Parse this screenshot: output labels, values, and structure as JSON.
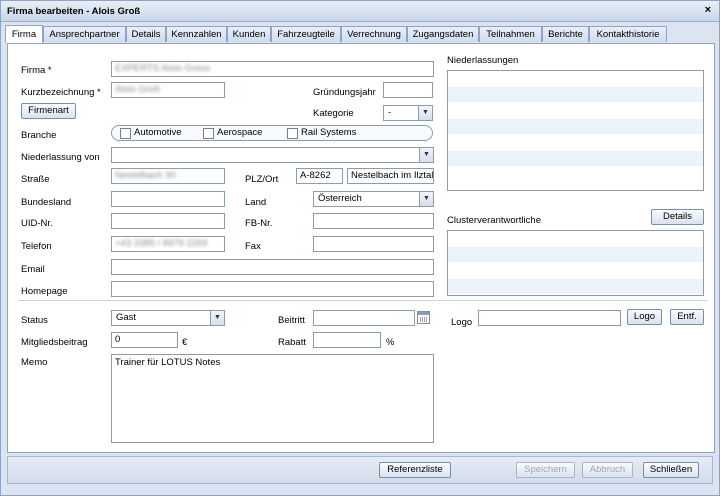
{
  "window": {
    "title": "Firma bearbeiten - Alois Groß",
    "close_glyph": "×"
  },
  "tabs": [
    "Firma",
    "Ansprechpartner",
    "Details",
    "Kennzahlen",
    "Kunden",
    "Fahrzeugteile",
    "Verrechnung",
    "Zugangsdaten",
    "Teilnahmen",
    "Berichte",
    "Kontakthistorie"
  ],
  "form": {
    "firma_label": "Firma *",
    "firma_value": "EXPERTS Alois Gross",
    "kurz_label": "Kurzbezeichnung *",
    "kurz_value": "Alois Groß",
    "firmenart_button": "Firmenart",
    "gruendung_label": "Gründungsjahr",
    "gruendung_value": "",
    "kategorie_label": "Kategorie",
    "kategorie_value": "-",
    "branche_label": "Branche",
    "branche_options": [
      "Automotive",
      "Aerospace",
      "Rail Systems"
    ],
    "nieder_von_label": "Niederlassung von",
    "nieder_von_value": "",
    "strasse_label": "Straße",
    "strasse_value": "Nestelbach 30",
    "plzort_label": "PLZ/Ort",
    "plz_value": "A-8262",
    "ort_value": "Nestelbach im Ilztal",
    "bundesland_label": "Bundesland",
    "bundesland_value": "",
    "land_label": "Land",
    "land_value": "Österreich",
    "uid_label": "UID-Nr.",
    "uid_value": "",
    "fb_label": "FB-Nr.",
    "fb_value": "",
    "telefon_label": "Telefon",
    "telefon_value": "+43 3385 / 8979 2269",
    "fax_label": "Fax",
    "fax_value": "",
    "email_label": "Email",
    "email_value": "",
    "homepage_label": "Homepage",
    "homepage_value": "",
    "status_label": "Status",
    "status_value": "Gast",
    "beitritt_label": "Beitritt",
    "beitritt_value": "",
    "logo_label": "Logo",
    "logo_value": "",
    "logo_button": "Logo",
    "entf_button": "Entf.",
    "mitglied_label": "Mitgliedsbeitrag",
    "mitglied_value": "0",
    "euro": "€",
    "rabatt_label": "Rabatt",
    "rabatt_value": "",
    "percent": "%",
    "memo_label": "Memo",
    "memo_value": "Trainer für LOTUS Notes"
  },
  "right": {
    "niederlassungen_label": "Niederlassungen",
    "cluster_label": "Clusterverantwortliche",
    "details_button": "Details"
  },
  "footer": {
    "referenzliste": "Referenzliste",
    "speichern": "Speichern",
    "abbruch": "Abbruch",
    "schliessen": "Schließen"
  },
  "icons": {
    "dropdown": "chevron-down-icon",
    "calendar": "calendar-icon",
    "close": "close-icon"
  }
}
